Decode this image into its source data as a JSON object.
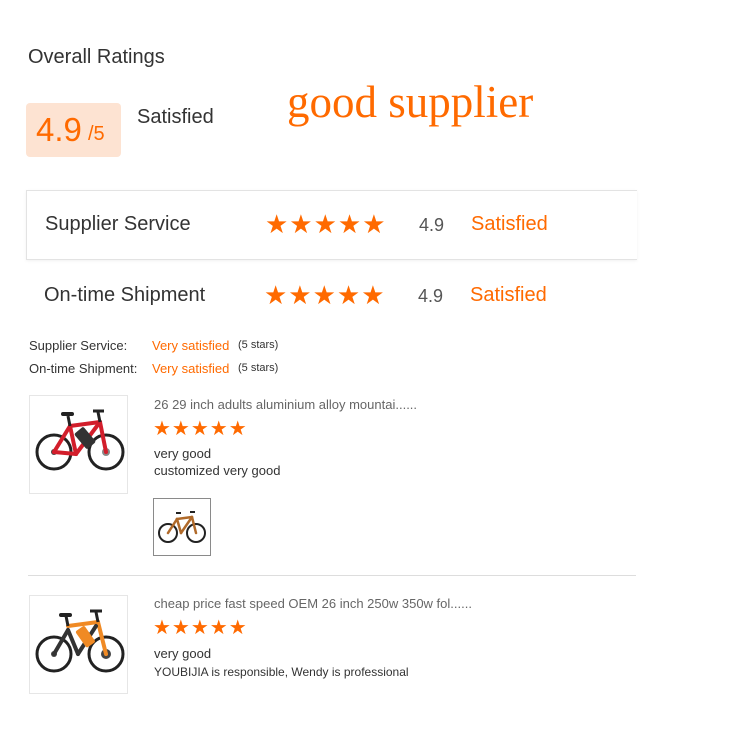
{
  "overall": {
    "title": "Overall Ratings",
    "score": "4.9",
    "out_of": "/5",
    "status": "Satisfied"
  },
  "overlay_text": "good supplier",
  "ratings": [
    {
      "label": "Supplier Service",
      "stars": 5,
      "stars_display": "★★★★★",
      "score": "4.9",
      "status": "Satisfied"
    },
    {
      "label": "On-time Shipment",
      "stars": 5,
      "stars_display": "★★★★★",
      "score": "4.9",
      "status": "Satisfied"
    }
  ],
  "summary": [
    {
      "label": "Supplier Service:",
      "value": "Very satisfied",
      "count": "(5 stars)"
    },
    {
      "label": "On-time Shipment:",
      "value": "Very satisfied",
      "count": "(5 stars)"
    }
  ],
  "reviews": [
    {
      "product": "26 29 inch adults aluminium alloy mountai......",
      "stars": 5,
      "stars_display": "★★★★★",
      "lines": [
        "very good",
        "customized very good"
      ],
      "bike_color": "#d21e2b"
    },
    {
      "product": "cheap price fast speed OEM 26 inch 250w 350w fol......",
      "stars": 5,
      "stars_display": "★★★★★",
      "lines": [
        "very good",
        "YOUBIJIA is responsible, Wendy is professional"
      ],
      "bike_color": "#f08a24"
    }
  ],
  "colors": {
    "accent": "#ff6a00",
    "score_bg": "#fde3d2",
    "text": "#333333"
  }
}
